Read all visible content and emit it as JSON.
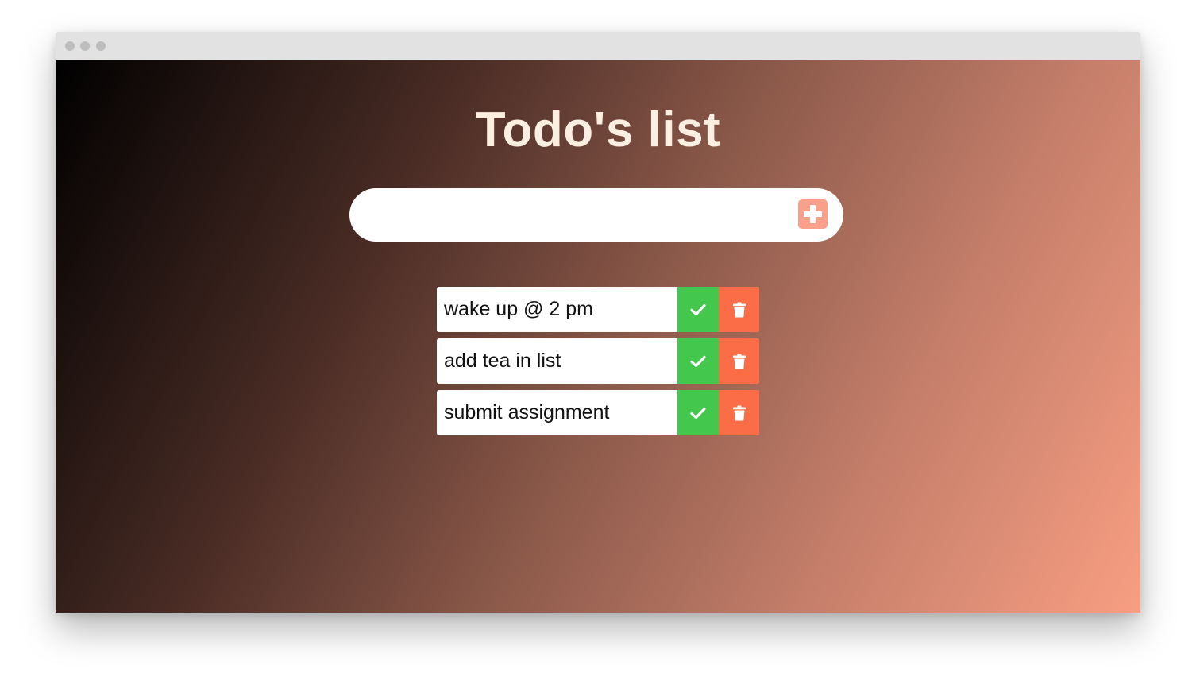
{
  "window": {
    "titlebar_dots": [
      "close-dot",
      "minimize-dot",
      "maximize-dot"
    ]
  },
  "page": {
    "title": "Todo's list"
  },
  "input": {
    "value": "",
    "placeholder": "",
    "add_icon": "plus-square-icon"
  },
  "todos": [
    {
      "text": "wake up @ 2 pm",
      "check_icon": "check-icon",
      "delete_icon": "trash-icon"
    },
    {
      "text": "add tea in list",
      "check_icon": "check-icon",
      "delete_icon": "trash-icon"
    },
    {
      "text": "submit assignment",
      "check_icon": "check-icon",
      "delete_icon": "trash-icon"
    }
  ],
  "colors": {
    "title": "#fbefe2",
    "add_button": "#f9a08a",
    "complete_button": "#43c84d",
    "delete_button": "#fa6d47",
    "gradient_start": "#000000",
    "gradient_end": "#f89e82"
  }
}
